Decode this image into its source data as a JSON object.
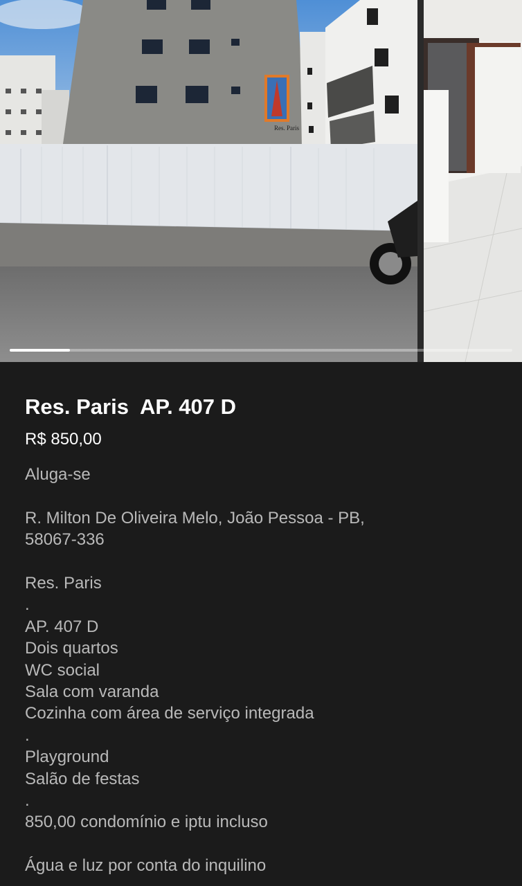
{
  "gallery": {
    "photos": [
      {
        "icon": "building-exterior-photo"
      },
      {
        "icon": "apartment-interior-photo"
      }
    ],
    "building_sign": "Res. Paris",
    "progress": 0.12
  },
  "listing": {
    "title": "Res. Paris  AP. 407 D",
    "price": "R$ 850,00",
    "description": [
      "Aluga-se",
      "",
      "R. Milton De Oliveira Melo, João Pessoa - PB,",
      "58067-336",
      "",
      "Res. Paris",
      ".",
      "AP. 407 D",
      "Dois quartos",
      "WC social",
      "Sala com varanda",
      "Cozinha com área de serviço integrada",
      ".",
      "Playground",
      "Salão de festas",
      ".",
      "850,00 condomínio e iptu incluso",
      "",
      "Água e luz por conta do inquilino"
    ]
  },
  "colors": {
    "background": "#1b1b1b",
    "title": "#ffffff",
    "body_text": "#b9b9b9"
  }
}
